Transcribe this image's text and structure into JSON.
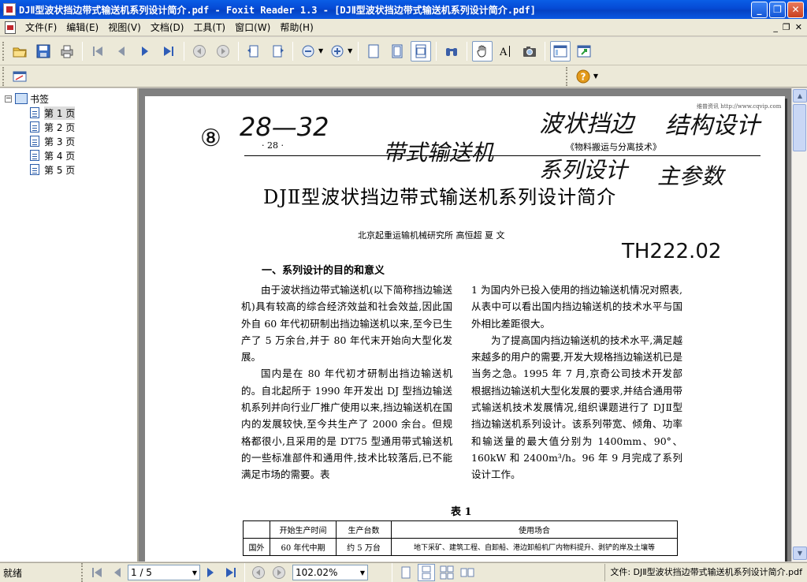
{
  "window": {
    "title": "DJⅡ型波状挡边带式输送机系列设计简介.pdf - Foxit Reader 1.3 - [DJⅡ型波状挡边带式输送机系列设计简介.pdf]",
    "minimize": "_",
    "restore": "❐",
    "close": "✕"
  },
  "menu": {
    "items": [
      "文件(F)",
      "编辑(E)",
      "视图(V)",
      "文档(D)",
      "工具(T)",
      "窗口(W)",
      "帮助(H)"
    ],
    "mdi_min": "_",
    "mdi_restore": "❐",
    "mdi_close": "✕"
  },
  "bookmarks": {
    "root": "书签",
    "pages": [
      "第 1 页",
      "第 2 页",
      "第 3 页",
      "第 4 页",
      "第 5 页"
    ],
    "toggle": "−"
  },
  "page": {
    "page_number": "· 28 ·",
    "journal": "《物料搬运与分离技术》",
    "url": "维普资讯 http://www.cqvip.com",
    "title": "DJⅡ型波状挡边带式输送机系列设计简介",
    "affiliation": "北京起重运输机械研究所  高恒超  夏  文",
    "section1": "一、系列设计的目的和意义",
    "col1": [
      "由于波状挡边带式输送机(以下简称挡边输送机)具有较高的综合经济效益和社会效益,因此国外自 60 年代初研制出挡边输送机以来,至今已生产了 5 万余台,并于 80 年代末开始向大型化发展。",
      "国内是在 80 年代初才研制出挡边输送机的。自北起所于 1990 年开发出 DJ 型挡边输送机系列并向行业厂推广使用以来,挡边输送机在国内的发展较快,至今共生产了 2000 余台。但规格都很小,且采用的是 DT75 型通用带式输送机的一些标准部件和通用件,技术比较落后,已不能满足市场的需要。表"
    ],
    "col2": [
      "1 为国内外已投入使用的挡边输送机情况对照表,从表中可以看出国内挡边输送机的技术水平与国外相比差距很大。",
      "为了提高国内挡边输送机的技术水平,满足越来越多的用户的需要,开发大规格挡边输送机已是当务之急。1995 年 7 月,京奇公司技术开发部根据挡边输送机大型化发展的要求,并结合通用带式输送机技术发展情况,组织课题进行了 DJⅡ型挡边输送机系列设计。该系列带宽、倾角、功率和输送量的最大值分别为 1400mm、90°、160kW 和 2400m³/h。96 年 9 月完成了系列设计工作。"
    ],
    "table_title": "表 1",
    "table_header": [
      "",
      "开始生产时间",
      "生产台数",
      "使用场合"
    ],
    "table_row": [
      "国外",
      "60 年代中期",
      "约 5 万台",
      "地下采矿、建筑工程、自卸船、港边卸船机厂内物料提升、剥铲的岸及土壤等"
    ],
    "handwriting": {
      "circle_num": "⑧",
      "range": "28—32",
      "note1": "波状挡边",
      "note2": "结构设计",
      "note3": "带式输送机",
      "note4": "系列设计",
      "note5": "主参数",
      "code": "TH222.02"
    }
  },
  "status": {
    "ready": "就绪",
    "page_field": "1 / 5",
    "zoom": "102.02%",
    "file": "文件: DJⅡ型波状挡边带式输送机系列设计简介.pdf"
  },
  "colors": {
    "titlebar": "#0549d4",
    "chrome": "#ece9d8",
    "doc_bg": "#808080"
  }
}
